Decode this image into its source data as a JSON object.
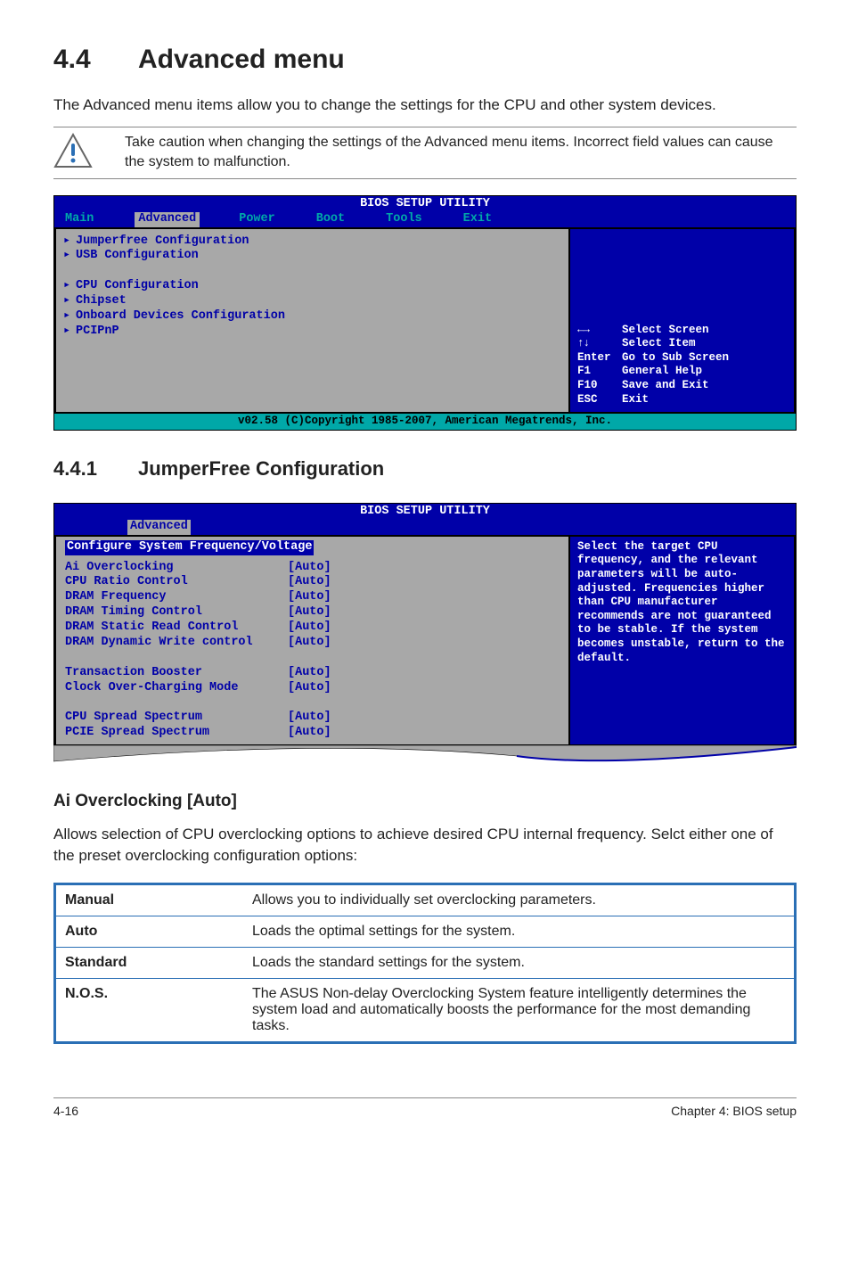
{
  "heading": {
    "number": "4.4",
    "title": "Advanced menu"
  },
  "intro": "The Advanced menu items allow you to change the settings for the CPU and other system devices.",
  "caution": "Take caution when changing the settings of the Advanced menu items. Incorrect field values can cause the system to malfunction.",
  "bios1": {
    "title": "BIOS SETUP UTILITY",
    "tabs": [
      "Main",
      "Advanced",
      "Power",
      "Boot",
      "Tools",
      "Exit"
    ],
    "items": [
      "Jumperfree Configuration",
      "USB Configuration",
      "",
      "CPU Configuration",
      "Chipset",
      "Onboard Devices Configuration",
      "PCIPnP"
    ],
    "keys": [
      {
        "k": "←→",
        "d": "Select Screen"
      },
      {
        "k": "↑↓",
        "d": "Select Item"
      },
      {
        "k": "Enter",
        "d": "Go to Sub Screen"
      },
      {
        "k": "F1",
        "d": "General Help"
      },
      {
        "k": "F10",
        "d": "Save and Exit"
      },
      {
        "k": "ESC",
        "d": "Exit"
      }
    ],
    "footer": "v02.58 (C)Copyright 1985-2007, American Megatrends, Inc."
  },
  "subsection": {
    "number": "4.4.1",
    "title": "JumperFree Configuration"
  },
  "bios2": {
    "title": "BIOS SETUP UTILITY",
    "tab": "Advanced",
    "header": "Configure System Frequency/Voltage",
    "rows": [
      {
        "label": "Ai Overclocking",
        "val": "[Auto]"
      },
      {
        "label": "CPU Ratio Control",
        "val": "[Auto]"
      },
      {
        "label": "DRAM Frequency",
        "val": "[Auto]"
      },
      {
        "label": "DRAM Timing Control",
        "val": "[Auto]"
      },
      {
        "label": "DRAM Static Read Control",
        "val": "[Auto]"
      },
      {
        "label": "DRAM Dynamic Write control",
        "val": "[Auto]"
      },
      {
        "label": "",
        "val": ""
      },
      {
        "label": "Transaction Booster",
        "val": "[Auto]"
      },
      {
        "label": "Clock Over-Charging Mode",
        "val": "[Auto]"
      },
      {
        "label": "",
        "val": ""
      },
      {
        "label": "CPU  Spread Spectrum",
        "val": "[Auto]"
      },
      {
        "label": "PCIE Spread Spectrum",
        "val": "[Auto]"
      }
    ],
    "help": "Select the target CPU frequency, and the relevant parameters will be auto-adjusted. Frequencies higher than CPU manufacturer recommends are not guaranteed to be stable. If the system becomes unstable, return to the default."
  },
  "field": {
    "title": "Ai Overclocking [Auto]",
    "desc": "Allows selection of CPU overclocking options to achieve desired CPU internal frequency. Selct either one of the preset overclocking configuration options:"
  },
  "options": [
    {
      "name": "Manual",
      "desc": "Allows you to individually set overclocking parameters."
    },
    {
      "name": "Auto",
      "desc": "Loads the optimal settings for the system."
    },
    {
      "name": "Standard",
      "desc": "Loads the standard settings for the system."
    },
    {
      "name": "N.O.S.",
      "desc": "The ASUS Non-delay Overclocking System feature intelligently determines the system load and automatically boosts the performance for the most demanding tasks."
    }
  ],
  "footer": {
    "left": "4-16",
    "right": "Chapter 4: BIOS setup"
  }
}
